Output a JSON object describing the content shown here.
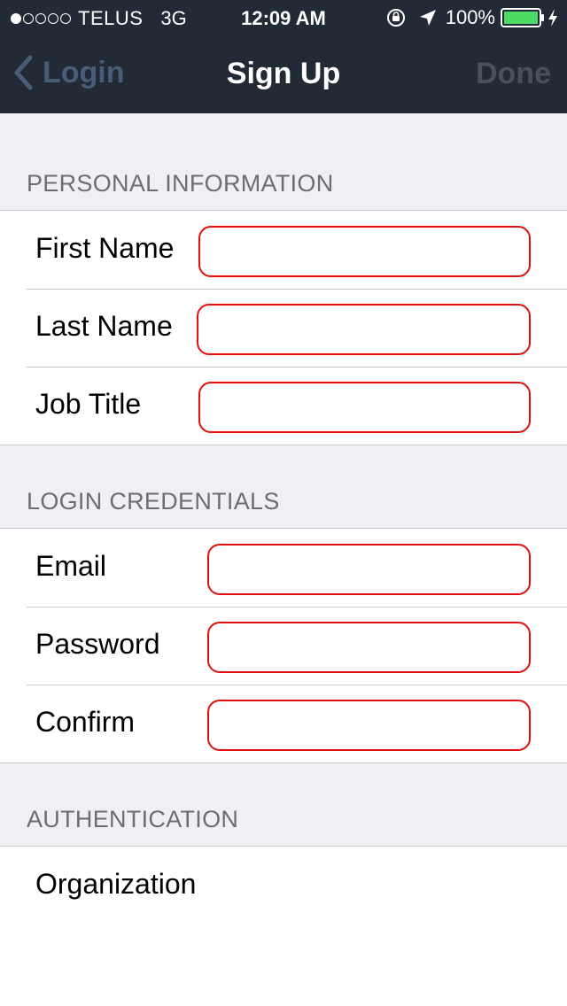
{
  "status_bar": {
    "carrier": "TELUS",
    "network": "3G",
    "time": "12:09 AM",
    "battery_percent": "100%",
    "signal_bars_filled": 1,
    "signal_bars_total": 5,
    "battery_color": "#4cd964"
  },
  "nav": {
    "back_label": "Login",
    "title": "Sign Up",
    "done_label": "Done"
  },
  "sections": {
    "personal": {
      "header": "PERSONAL INFORMATION",
      "first_name": {
        "label": "First Name",
        "value": ""
      },
      "last_name": {
        "label": "Last Name",
        "value": ""
      },
      "job_title": {
        "label": "Job Title",
        "value": ""
      }
    },
    "login": {
      "header": "LOGIN CREDENTIALS",
      "email": {
        "label": "Email",
        "value": ""
      },
      "password": {
        "label": "Password",
        "value": ""
      },
      "confirm": {
        "label": "Confirm",
        "value": ""
      }
    },
    "auth": {
      "header": "AUTHENTICATION",
      "organization": {
        "label": "Organization"
      }
    }
  },
  "colors": {
    "nav_background": "#222a35",
    "invalid_field_border": "#e01010",
    "group_background": "#efeff4"
  }
}
